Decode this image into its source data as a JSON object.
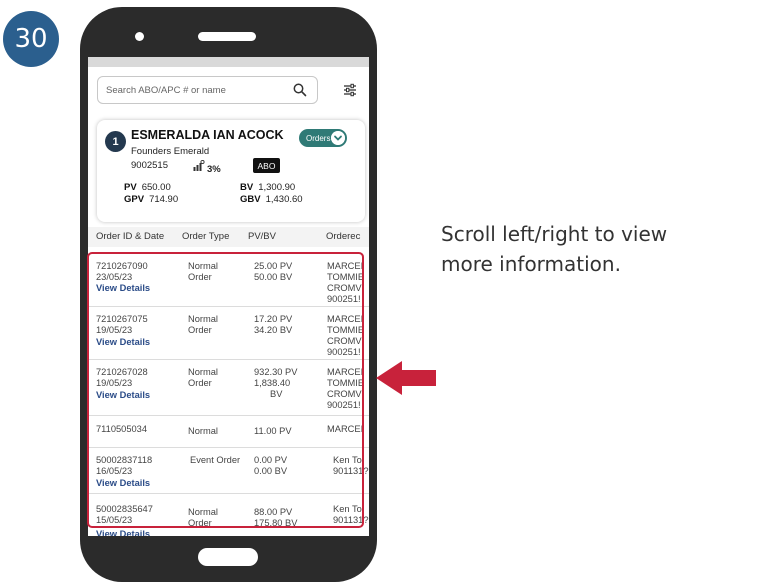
{
  "step_number": "30",
  "instruction": {
    "line1": "Scroll left/right to view",
    "line2": "more information."
  },
  "search": {
    "placeholder": "Search ABO/APC # or name",
    "value": ""
  },
  "icons": {
    "search": "search-icon",
    "filter": "filter-sliders-icon",
    "percent": "growth-bars-icon",
    "arrow": "arrow-left-icon"
  },
  "card": {
    "rank": "1",
    "name": "ESMERALDA IAN ACOCK",
    "title": "Founders Emerald",
    "abo_number": "9002515",
    "percent": "3%",
    "type_badge": "ABO",
    "orders_button": "Orders",
    "pv_label": "PV",
    "pv_value": "650.00",
    "gpv_label": "GPV",
    "gpv_value": "714.90",
    "bv_label": "BV",
    "bv_value": "1,300.90",
    "gbv_label": "GBV",
    "gbv_value": "1,430.60"
  },
  "table": {
    "headers": [
      "Order ID & Date",
      "Order Type",
      "PV/BV",
      "Orderec"
    ],
    "view_details": "View Details",
    "rows": [
      {
        "id": "7210267090",
        "date": "23/05/23",
        "type1": "Normal",
        "type2": "Order",
        "pv": "25.00 PV",
        "bv": "50.00 BV",
        "bv2": "",
        "o1": "MARCEI",
        "o2": "TOMMIE",
        "o3": "CROMV",
        "o4": "900251!"
      },
      {
        "id": "7210267075",
        "date": "19/05/23",
        "type1": "Normal",
        "type2": "Order",
        "pv": "17.20 PV",
        "bv": "34.20 BV",
        "bv2": "",
        "o1": "MARCEI",
        "o2": "TOMMIE",
        "o3": "CROMV",
        "o4": "900251!"
      },
      {
        "id": "7210267028",
        "date": "19/05/23",
        "type1": "Normal",
        "type2": "Order",
        "pv": "932.30 PV",
        "bv": "1,838.40",
        "bv2": "BV",
        "o1": "MARCEI",
        "o2": "TOMMIE",
        "o3": "CROMV",
        "o4": "900251!"
      },
      {
        "id": "7110505034",
        "date": "",
        "type1": "Normal",
        "type2": "",
        "pv": "11.00 PV",
        "bv": "",
        "bv2": "",
        "o1": "MARCEI",
        "o2": "",
        "o3": "",
        "o4": ""
      },
      {
        "id": "50002837118",
        "date": "16/05/23",
        "type1": "Event Order",
        "type2": "",
        "pv": "0.00 PV",
        "bv": "0.00 BV",
        "bv2": "",
        "o1": "Ken Tol",
        "o2": "901131?",
        "o3": "",
        "o4": ""
      },
      {
        "id": "50002835647",
        "date": "15/05/23",
        "type1": "Normal",
        "type2": "Order",
        "pv": "88.00 PV",
        "bv": "175.80 BV",
        "bv2": "",
        "o1": "Ken Tol",
        "o2": "901131?",
        "o3": "",
        "o4": ""
      }
    ]
  },
  "colors": {
    "badge_blue": "#2b5f8e",
    "phone_frame": "#2b2b2b",
    "highlight_red": "#c8223b",
    "orders_teal": "#2f7a76",
    "link_blue": "#2b4c88"
  }
}
